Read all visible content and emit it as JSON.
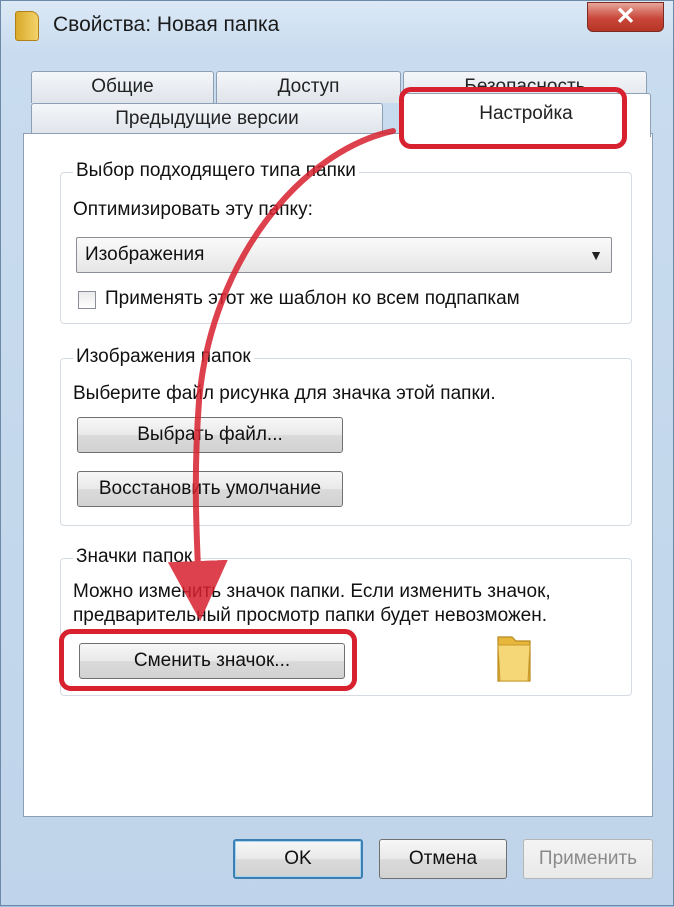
{
  "window": {
    "title": "Свойства: Новая папка",
    "close_symbol": "✕"
  },
  "tabs": {
    "row1": [
      "Общие",
      "Доступ",
      "Безопасность"
    ],
    "row2": [
      "Предыдущие версии",
      "Настройка"
    ],
    "active": "Настройка"
  },
  "folder_type": {
    "group_title": "Выбор подходящего типа папки",
    "optimize_label": "Оптимизировать эту папку:",
    "selected_value": "Изображения",
    "apply_template_label": "Применять этот же шаблон ко всем подпапкам",
    "apply_template_checked": false
  },
  "folder_pictures": {
    "group_title": "Изображения папок",
    "description": "Выберите файл рисунка для значка этой папки.",
    "choose_file_button": "Выбрать файл...",
    "restore_default_button": "Восстановить умолчание"
  },
  "folder_icons": {
    "group_title": "Значки папок",
    "description_line1": "Можно изменить значок папки. Если изменить значок,",
    "description_line2": "предварительный просмотр папки будет невозможен.",
    "change_icon_button": "Сменить значок..."
  },
  "footer": {
    "ok_button": "OK",
    "cancel_button": "Отмена",
    "apply_button": "Применить"
  },
  "icons": {
    "app": "folder-icon",
    "close": "close-icon",
    "dropdown": "chevron-down-icon",
    "preview": "folder-icon"
  },
  "colors": {
    "annotation": "#d8212e",
    "window_frame": "#c9dcef",
    "close_button": "#c9473a"
  }
}
